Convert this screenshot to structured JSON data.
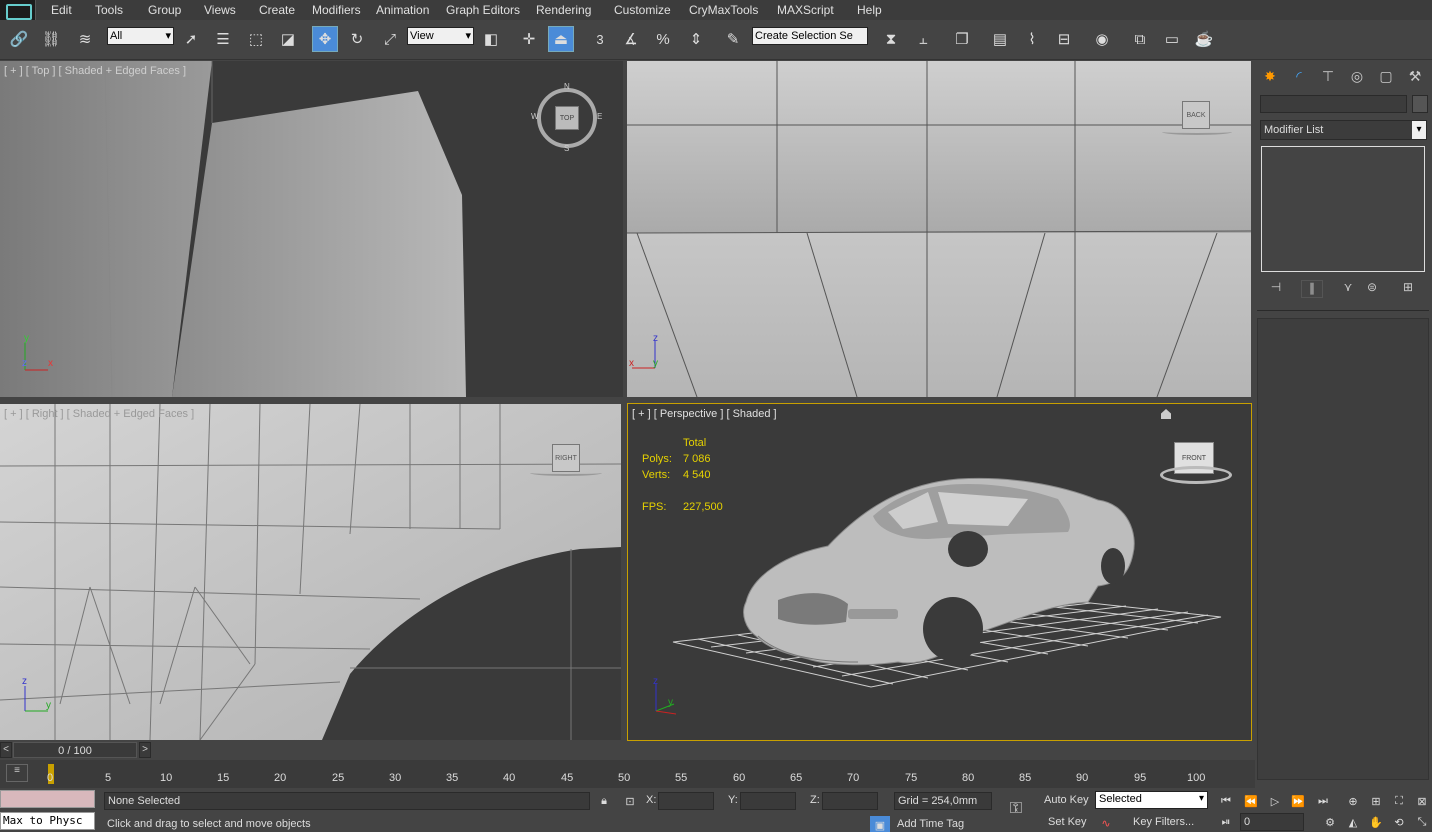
{
  "menu": {
    "items": [
      "Edit",
      "Tools",
      "Group",
      "Views",
      "Create",
      "Modifiers",
      "Animation",
      "Graph Editors",
      "Rendering",
      "Customize",
      "CryMaxTools",
      "MAXScript",
      "Help"
    ]
  },
  "toolbar": {
    "selection_filter": "All",
    "reference_coord": "View",
    "snap_angle_label": "3",
    "named_selection_placeholder": "Create Selection Se"
  },
  "viewports": {
    "top": {
      "label": "[ + ] [ Top ] [ Shaded + Edged Faces ]",
      "gizmo_label": "TOP",
      "axis_y": "y",
      "axis_z": "z",
      "axis_x": "x",
      "compass": [
        "N",
        "W",
        "E",
        "S"
      ]
    },
    "back": {
      "gizmo_label": "BACK",
      "axis_z": "z",
      "axis_x": "x",
      "axis_y": "y"
    },
    "right": {
      "label": "[ + ] [ Right ] [ Shaded + Edged Faces ]",
      "gizmo_label": "RIGHT",
      "axis_z": "z",
      "axis_y": "y"
    },
    "perspective": {
      "label": "[ + ] [ Perspective ] [ Shaded ]",
      "gizmo_label": "FRONT",
      "stats": {
        "header": "Total",
        "polys_label": "Polys:",
        "polys_value": "7 086",
        "verts_label": "Verts:",
        "verts_value": "4 540",
        "fps_label": "FPS:",
        "fps_value": "227,500"
      },
      "axis_z": "z",
      "axis_y": "y"
    }
  },
  "command_panel": {
    "name_field": "",
    "modifier_list": "Modifier List",
    "tabs": [
      "create-icon",
      "modify-icon",
      "hierarchy-icon",
      "motion-icon",
      "display-icon",
      "utilities-icon"
    ]
  },
  "timeline": {
    "slider_label": "0 / 100",
    "prev": "<",
    "next": ">",
    "ticks": [
      "0",
      "5",
      "10",
      "15",
      "20",
      "25",
      "30",
      "35",
      "40",
      "45",
      "50",
      "55",
      "60",
      "65",
      "70",
      "75",
      "80",
      "85",
      "90",
      "95",
      "100"
    ]
  },
  "status": {
    "maxscript_listener": "Max to Physc",
    "selection": "None Selected",
    "prompt": "Click and drag to select and move objects",
    "x_label": "X:",
    "y_label": "Y:",
    "z_label": "Z:",
    "grid": "Grid = 254,0mm",
    "add_time_tag": "Add Time Tag",
    "auto_key": "Auto Key",
    "set_key": "Set Key",
    "key_mode": "Selected",
    "key_filters": "Key Filters...",
    "frame": "0"
  },
  "colors": {
    "viewport_dark": "#3a3a3a",
    "viewport_gray": "#b9b9b9",
    "active_border": "#c8a000",
    "stat_yellow": "#e6d200",
    "accent_blue": "#4a8bd8"
  }
}
